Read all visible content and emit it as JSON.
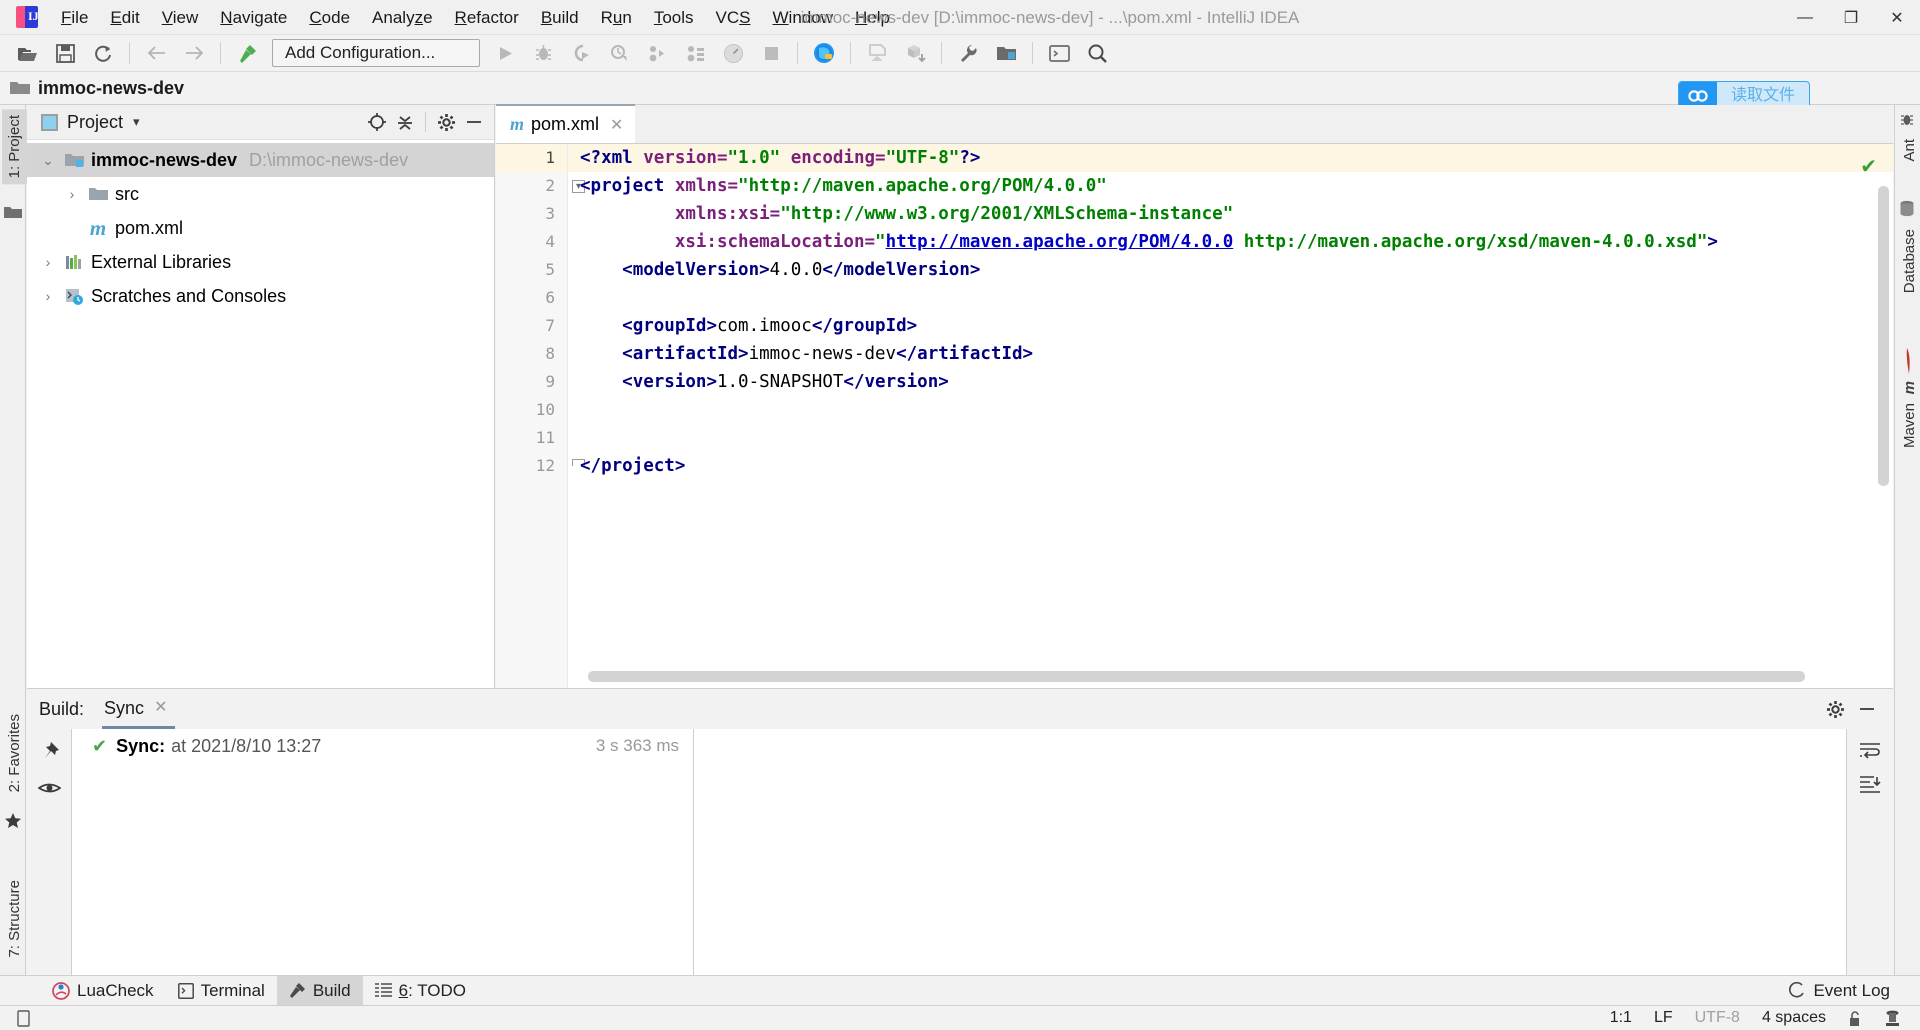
{
  "window": {
    "title": "immoc-news-dev [D:\\immoc-news-dev] - ...\\pom.xml - IntelliJ IDEA",
    "minimize": "—",
    "maximize": "❐",
    "close": "✕"
  },
  "menu": [
    {
      "label": "File",
      "mnemonic": "F"
    },
    {
      "label": "Edit",
      "mnemonic": "E"
    },
    {
      "label": "View",
      "mnemonic": "V"
    },
    {
      "label": "Navigate",
      "mnemonic": "N"
    },
    {
      "label": "Code",
      "mnemonic": "C"
    },
    {
      "label": "Analyze",
      "mnemonic": "z"
    },
    {
      "label": "Refactor",
      "mnemonic": "R"
    },
    {
      "label": "Build",
      "mnemonic": "B"
    },
    {
      "label": "Run",
      "mnemonic": "u"
    },
    {
      "label": "Tools",
      "mnemonic": "T"
    },
    {
      "label": "VCS",
      "mnemonic": "S"
    },
    {
      "label": "Window",
      "mnemonic": "W"
    },
    {
      "label": "Help",
      "mnemonic": "H"
    }
  ],
  "toolbar": {
    "run_configuration": "Add Configuration...",
    "icons": [
      "open-folder-icon",
      "save-all-icon",
      "sync-refresh-icon",
      "back-arrow-icon",
      "forward-arrow-icon",
      "build-hammer-icon",
      "run-icon",
      "debug-icon",
      "run-with-coverage-icon",
      "profile-icon",
      "attach-profiler-icon",
      "run-tests-icon",
      "gauge-icon",
      "stop-icon",
      "update-project-icon",
      "commit-icon",
      "push-icon",
      "settings-wrench-icon",
      "project-structure-icon",
      "terminal-icon",
      "search-everywhere-icon"
    ]
  },
  "navbar": {
    "crumb": "immoc-news-dev"
  },
  "netdisk_widget": {
    "icon": "baidu-netdisk-icon",
    "label": "读取文件"
  },
  "left_strip": {
    "tabs": [
      "1: Project"
    ],
    "icons": [
      "structure-folder-icon"
    ],
    "bottom_tabs": [
      "2: Favorites",
      "7: Structure"
    ]
  },
  "right_strip": {
    "tabs": [
      "Ant",
      "Database",
      "Maven"
    ]
  },
  "project_panel": {
    "title": "Project",
    "dropdown": "▾",
    "buttons": [
      "locate-target-icon",
      "collapse-all-icon",
      "settings-gear-icon",
      "hide-icon"
    ],
    "tree": [
      {
        "label": "immoc-news-dev",
        "path": "D:\\immoc-news-dev",
        "icon": "module-folder-icon",
        "arrow": "⌄",
        "depth": 0,
        "bold": true,
        "selected": true
      },
      {
        "label": "src",
        "path": "",
        "icon": "folder-icon",
        "arrow": "›",
        "depth": 1,
        "bold": false,
        "selected": false
      },
      {
        "label": "pom.xml",
        "path": "",
        "icon": "maven-file-icon",
        "arrow": "",
        "depth": 1,
        "bold": false,
        "selected": false
      },
      {
        "label": "External Libraries",
        "path": "",
        "icon": "libraries-icon",
        "arrow": "›",
        "depth": 0,
        "bold": false,
        "selected": false
      },
      {
        "label": "Scratches and Consoles",
        "path": "",
        "icon": "scratches-icon",
        "arrow": "›",
        "depth": 0,
        "bold": false,
        "selected": false
      }
    ]
  },
  "editor": {
    "tab": {
      "label": "pom.xml",
      "icon": "maven-file-icon",
      "close": "✕"
    },
    "inspection_status": "✔",
    "lines": [
      {
        "n": "1",
        "text": "<?xml version=\"1.0\" encoding=\"UTF-8\"?>"
      },
      {
        "n": "2",
        "text": "<project xmlns=\"http://maven.apache.org/POM/4.0.0\""
      },
      {
        "n": "3",
        "text": "         xmlns:xsi=\"http://www.w3.org/2001/XMLSchema-instance\""
      },
      {
        "n": "4",
        "text": "         xsi:schemaLocation=\"http://maven.apache.org/POM/4.0.0 http://maven.apache.org/xsd/maven-4.0.0.xsd\">"
      },
      {
        "n": "5",
        "text": "    <modelVersion>4.0.0</modelVersion>"
      },
      {
        "n": "6",
        "text": ""
      },
      {
        "n": "7",
        "text": "    <groupId>com.imooc</groupId>"
      },
      {
        "n": "8",
        "text": "    <artifactId>immoc-news-dev</artifactId>"
      },
      {
        "n": "9",
        "text": "    <version>1.0-SNAPSHOT</version>"
      },
      {
        "n": "10",
        "text": ""
      },
      {
        "n": "11",
        "text": ""
      },
      {
        "n": "12",
        "text": "</project>"
      }
    ]
  },
  "build_panel": {
    "label": "Build:",
    "tab": "Sync",
    "tab_close": "✕",
    "header_buttons": [
      "settings-gear-icon",
      "hide-icon"
    ],
    "sidebar_icons": [
      "pin-icon",
      "eye-icon"
    ],
    "right_icons": [
      "soft-wrap-icon",
      "scroll-to-end-icon"
    ],
    "rows": [
      {
        "status": "✔",
        "title": "Sync:",
        "detail": "at 2021/8/10 13:27",
        "duration": "3 s 363 ms"
      }
    ]
  },
  "bottom_bar": {
    "items": [
      {
        "label": "LuaCheck",
        "icon": "luacheck-icon",
        "selected": false,
        "mnemonic": ""
      },
      {
        "label": "Terminal",
        "icon": "terminal-icon",
        "selected": false,
        "mnemonic": ""
      },
      {
        "label": "Build",
        "icon": "build-hammer-icon",
        "selected": true,
        "mnemonic": ""
      },
      {
        "label": "6: TODO",
        "icon": "todo-icon",
        "selected": false,
        "mnemonic": "6"
      }
    ],
    "event_log": {
      "label": "Event Log",
      "icon": "event-log-icon"
    }
  },
  "statusbar": {
    "left_icon": "memory-indicator-icon",
    "caret": "1:1",
    "line_sep": "LF",
    "encoding": "UTF-8",
    "indent": "4 spaces",
    "lock_icon": "unlocked-icon",
    "inspector_icon": "hector-icon"
  }
}
